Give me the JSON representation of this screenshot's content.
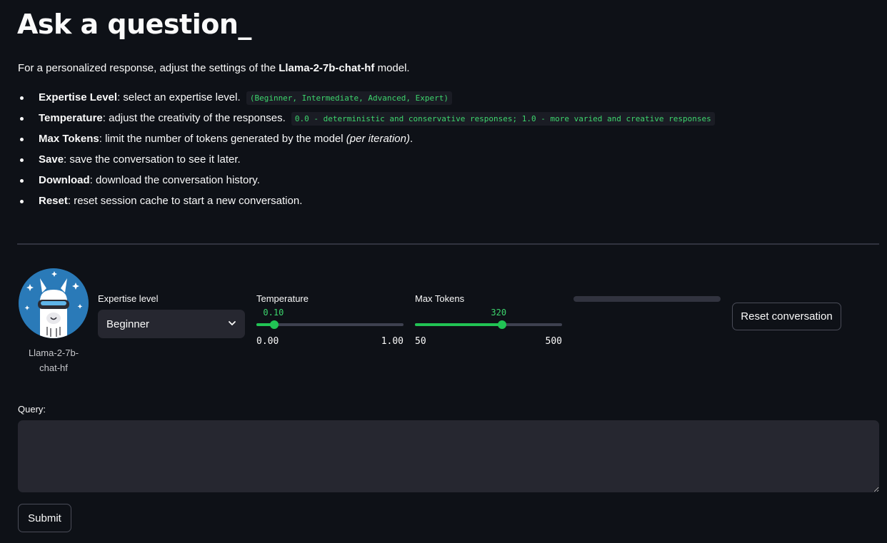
{
  "header": {
    "title": "Ask a question_"
  },
  "intro": {
    "prefix": "For a personalized response, adjust the settings of the ",
    "model": "Llama-2-7b-chat-hf",
    "suffix": " model."
  },
  "bullets": [
    {
      "term": "Expertise Level",
      "text": ": select an expertise level.",
      "code": "(Beginner, Intermediate, Advanced, Expert)"
    },
    {
      "term": "Temperature",
      "text": ": adjust the creativity of the responses.",
      "code": "0.0 - deterministic and conservative responses; 1.0 - more varied and creative responses"
    },
    {
      "term": "Max Tokens",
      "text": ": limit the number of tokens generated by the model ",
      "italic": "(per iteration)",
      "tail": "."
    },
    {
      "term": "Save",
      "text": ": save the conversation to see it later."
    },
    {
      "term": "Download",
      "text": ": download the conversation history."
    },
    {
      "term": "Reset",
      "text": ": reset session cache to start a new conversation."
    }
  ],
  "avatar": {
    "caption": "Llama-2-7b-chat-hf",
    "icon": "llama-avatar-icon"
  },
  "expertise": {
    "label": "Expertise level",
    "selected": "Beginner"
  },
  "temperature": {
    "label": "Temperature",
    "value": "0.10",
    "min": "0.00",
    "max": "1.00",
    "fraction": 0.1
  },
  "max_tokens": {
    "label": "Max Tokens",
    "value": "320",
    "min": "50",
    "max": "500",
    "fraction": 0.6
  },
  "progress": {
    "fraction": 0
  },
  "buttons": {
    "reset": "Reset conversation",
    "submit": "Submit"
  },
  "query": {
    "label": "Query:",
    "value": ""
  },
  "colors": {
    "background": "#0e1117",
    "accent": "#21c354",
    "code": "#3dd56d",
    "input_bg": "#262730"
  }
}
